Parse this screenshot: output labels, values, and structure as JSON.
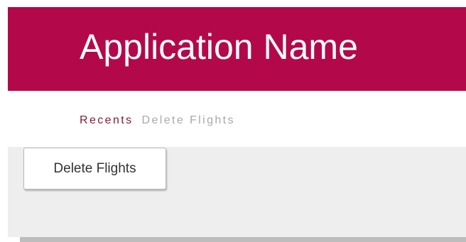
{
  "header": {
    "title": "Application Name",
    "background_color": "#b3094b"
  },
  "nav": {
    "tabs": [
      {
        "label": "Recents",
        "active": true
      },
      {
        "label": "Delete Flights",
        "active": false
      }
    ],
    "active_color": "#8a1838",
    "inactive_color": "#a9a9a9"
  },
  "main": {
    "delete_button_label": "Delete Flights"
  }
}
